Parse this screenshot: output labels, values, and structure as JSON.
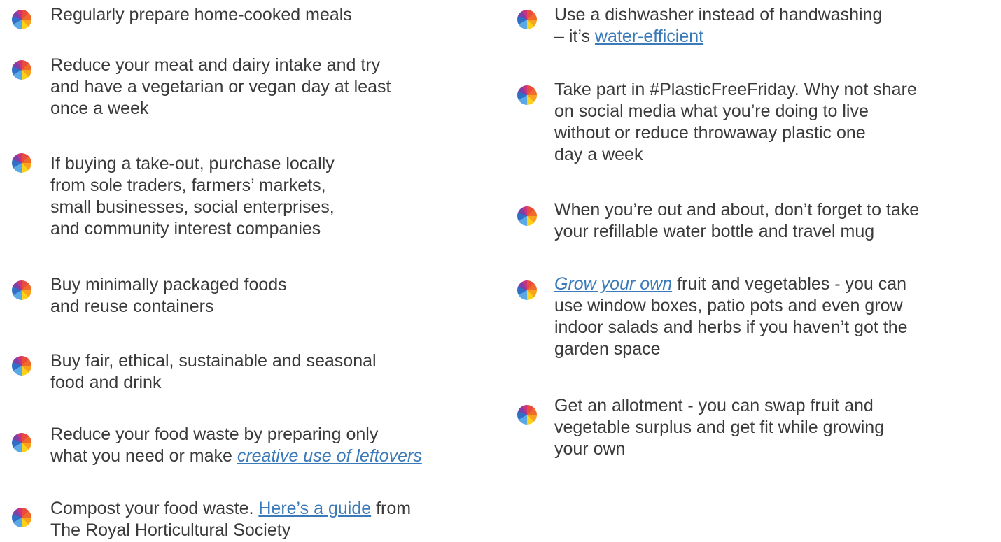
{
  "left": {
    "items": [
      {
        "lines": [
          "Regularly prepare home-cooked meals"
        ]
      },
      {
        "lines": [
          "Reduce your meat and dairy intake and try",
          "and have a vegetarian or vegan day at least",
          "once a week"
        ]
      },
      {
        "lines": [
          "If buying a take-out, purchase locally",
          "from sole traders, farmers’ markets,",
          "small businesses, social enterprises,",
          "and community interest companies"
        ]
      },
      {
        "lines": [
          "Buy minimally packaged foods",
          "and reuse containers"
        ]
      },
      {
        "lines": [
          "Buy fair, ethical, sustainable and seasonal",
          "food and drink"
        ]
      },
      {
        "line1": "Reduce your food waste by preparing only",
        "line2_pre": "what you need or make ",
        "link": "creative use of leftovers"
      },
      {
        "line1_pre": "Compost your food waste. ",
        "link": "Here’s a guide",
        "line1_post": " from",
        "line2": "The Royal Horticultural Society"
      }
    ]
  },
  "right": {
    "items": [
      {
        "line1": "Use a dishwasher instead of handwashing",
        "line2_pre": "– it’s ",
        "link": "water-efficient"
      },
      {
        "lines": [
          "Take part in #PlasticFreeFriday. Why not share",
          "on social media what you’re doing to live",
          "without or reduce throwaway plastic one",
          "day a week"
        ]
      },
      {
        "lines": [
          "When you’re out and about, don’t forget to take",
          "your refillable water bottle and travel mug"
        ]
      },
      {
        "link": "Grow your own",
        "line1_post": " fruit and vegetables - you can",
        "line2": "use window boxes, patio pots and even grow",
        "line3": "indoor salads and herbs if you haven’t got the",
        "line4": "garden space"
      },
      {
        "lines": [
          "Get an allotment - you can swap fruit and",
          "vegetable surplus and get fit while growing",
          "your own"
        ]
      }
    ]
  },
  "colors": {
    "text": "#3a3a3a",
    "link": "#3a7ab8"
  }
}
